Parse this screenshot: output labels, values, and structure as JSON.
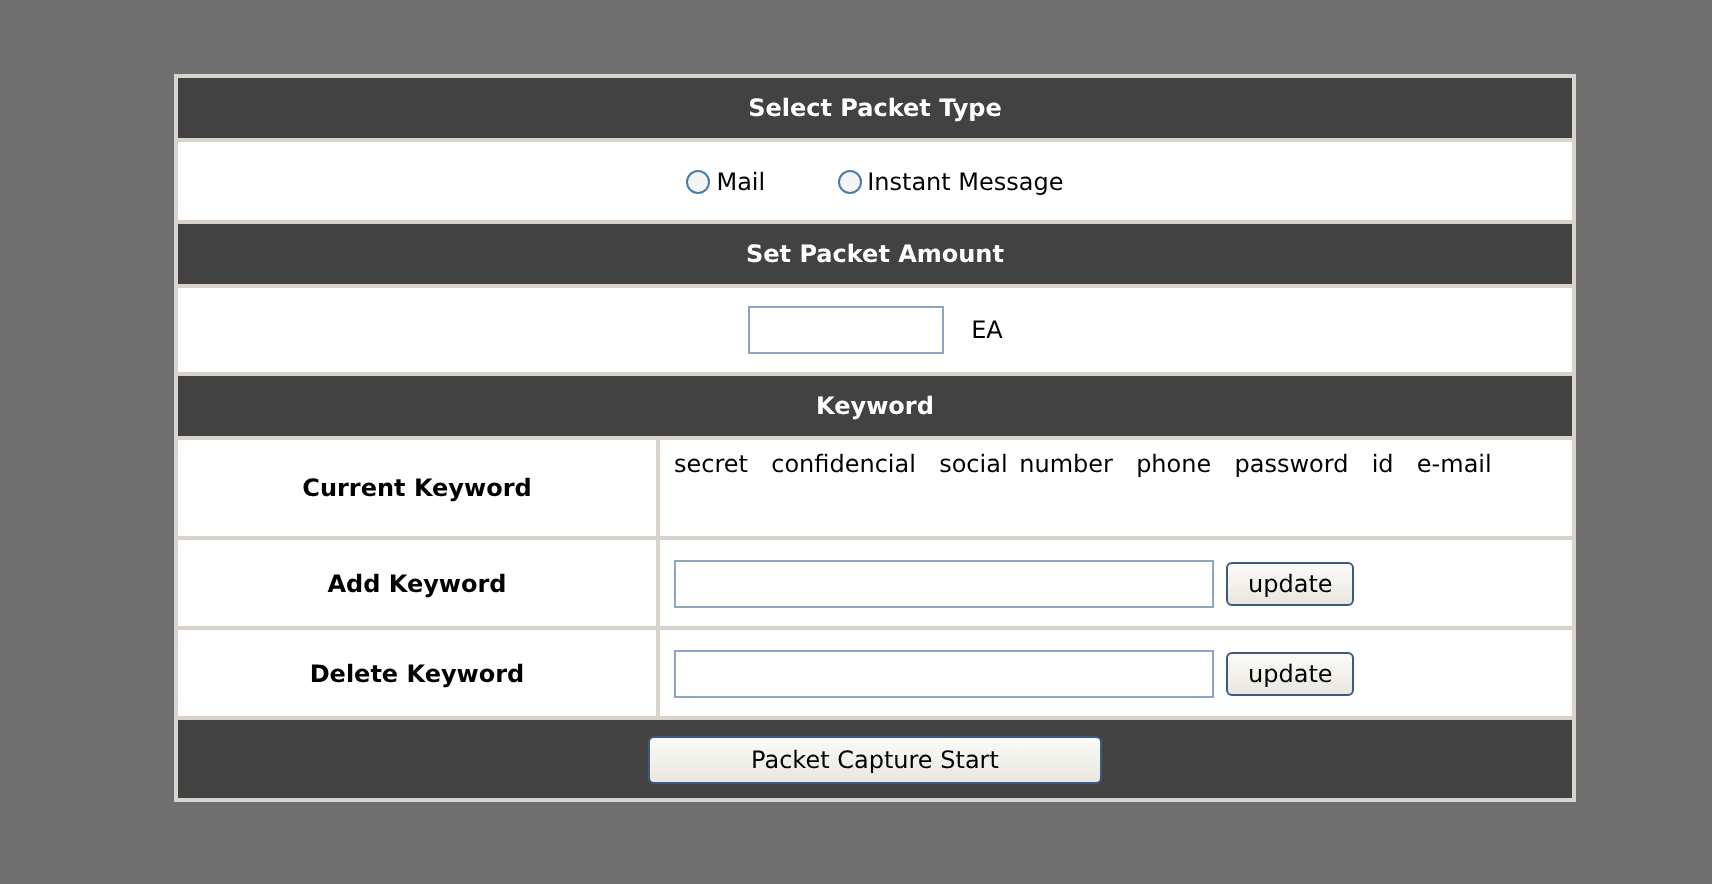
{
  "packet_type": {
    "heading": "Select Packet Type",
    "options": [
      {
        "label": "Mail",
        "selected": false
      },
      {
        "label": "Instant Message",
        "selected": false
      }
    ]
  },
  "packet_amount": {
    "heading": "Set Packet Amount",
    "unit": "EA"
  },
  "keyword": {
    "heading": "Keyword",
    "rows": [
      {
        "kind": "text",
        "label": "Current Keyword",
        "value": "secret  confidencial  social number  phone  password  id  e-mail"
      },
      {
        "kind": "input",
        "label": "Add Keyword",
        "button": "update"
      },
      {
        "kind": "input",
        "label": "Delete Keyword",
        "button": "update"
      }
    ]
  },
  "start_button": "Packet Capture Start"
}
